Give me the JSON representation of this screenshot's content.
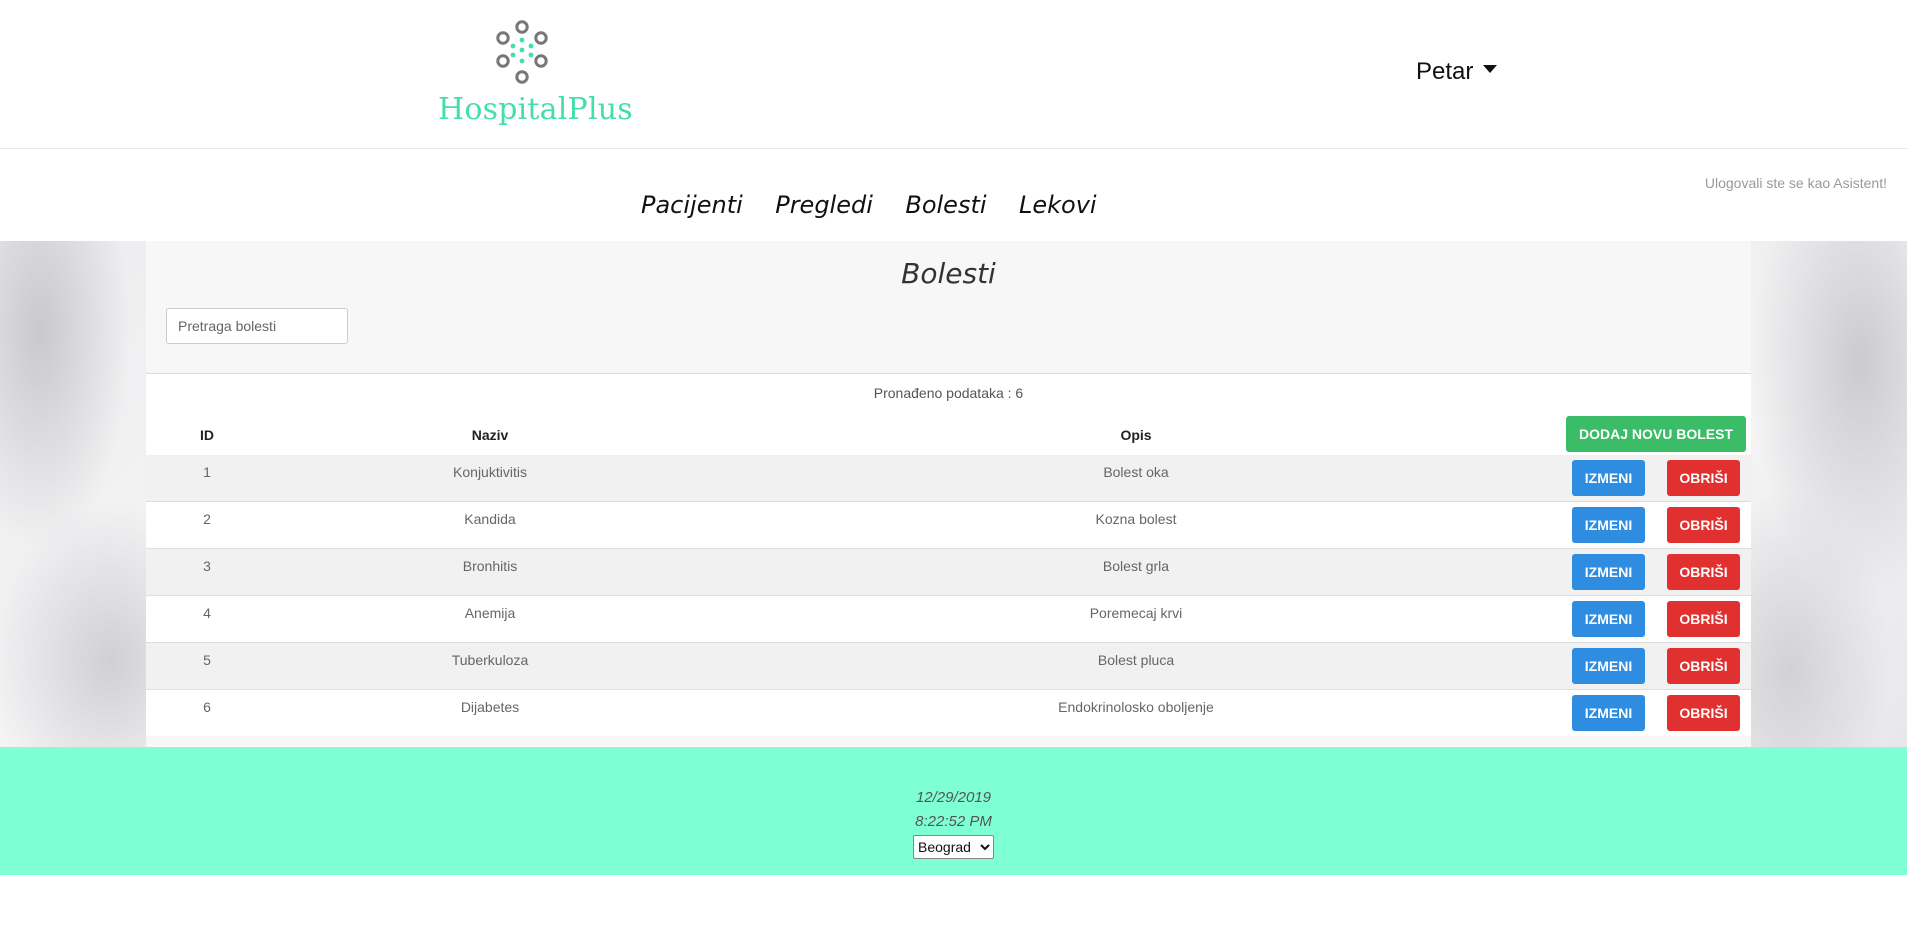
{
  "header": {
    "logo_text": "HospitalPlus",
    "user_name": "Petar"
  },
  "nav": {
    "links": [
      "Pacijenti",
      "Pregledi",
      "Bolesti",
      "Lekovi"
    ],
    "login_info": "Ulogovali ste se kao Asistent!"
  },
  "main": {
    "title": "Bolesti",
    "search_placeholder": "Pretraga bolesti",
    "found_text": "Pronađeno podataka : 6",
    "columns": {
      "id": "ID",
      "name": "Naziv",
      "desc": "Opis"
    },
    "add_button": "DODAJ NOVU BOLEST",
    "edit_label": "IZMENI",
    "delete_label": "OBRIŠI",
    "rows": [
      {
        "id": "1",
        "name": "Konjuktivitis",
        "desc": "Bolest oka"
      },
      {
        "id": "2",
        "name": "Kandida",
        "desc": "Kozna bolest"
      },
      {
        "id": "3",
        "name": "Bronhitis",
        "desc": "Bolest grla"
      },
      {
        "id": "4",
        "name": "Anemija",
        "desc": "Poremecaj krvi"
      },
      {
        "id": "5",
        "name": "Tuberkuloza",
        "desc": "Bolest pluca"
      },
      {
        "id": "6",
        "name": "Dijabetes",
        "desc": "Endokrinolosko oboljenje"
      }
    ]
  },
  "footer": {
    "date": "12/29/2019",
    "time": "8:22:52 PM",
    "city": "Beograd"
  },
  "colors": {
    "brand": "#44dfa8",
    "add_button": "#3bbd68",
    "edit_button": "#2e8de0",
    "delete_button": "#e0302f",
    "footer": "#7fffd4"
  }
}
